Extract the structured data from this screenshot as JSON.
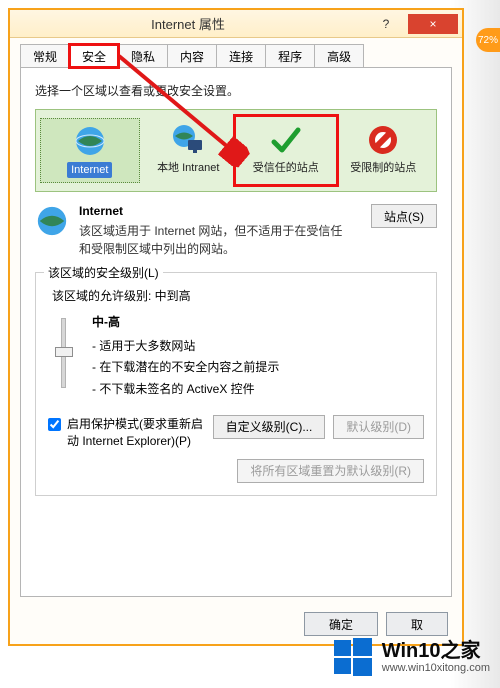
{
  "window": {
    "title": "Internet 属性",
    "help_icon": "?",
    "close_icon": "×"
  },
  "tabs": {
    "items": [
      {
        "label": "常规"
      },
      {
        "label": "安全",
        "active": true,
        "highlight": true
      },
      {
        "label": "隐私"
      },
      {
        "label": "内容"
      },
      {
        "label": "连接"
      },
      {
        "label": "程序"
      },
      {
        "label": "高级"
      }
    ]
  },
  "instruction": "选择一个区域以查看或更改安全设置。",
  "zones": [
    {
      "id": "internet",
      "label": "Internet",
      "selected": true
    },
    {
      "id": "local-intranet",
      "label": "本地 Intranet"
    },
    {
      "id": "trusted-sites",
      "label": "受信任的站点",
      "highlight": true
    },
    {
      "id": "restricted-sites",
      "label": "受限制的站点"
    }
  ],
  "description": {
    "title": "Internet",
    "text_line1": "该区域适用于 Internet 网站，但不适用于在受信任",
    "text_line2": "和受限制区域中列出的网站。",
    "sites_button": "站点(S)"
  },
  "sec_level": {
    "group_label": "该区域的安全级别(L)",
    "allowed_label": "该区域的允许级别: 中到高",
    "level_name": "中-高",
    "bullets": [
      "- 适用于大多数网站",
      "- 在下载潜在的不安全内容之前提示",
      "- 不下载未签名的 ActiveX 控件"
    ],
    "protected_mode": "启用保护模式(要求重新启动 Internet Explorer)(P)",
    "custom_button": "自定义级别(C)...",
    "default_button": "默认级别(D)",
    "reset_button": "将所有区域重置为默认级别(R)"
  },
  "footer": {
    "ok": "确定",
    "cancel": "取"
  },
  "watermark": {
    "main": "Win10之家",
    "sub": "www.win10xitong.com"
  },
  "badge": "72%"
}
